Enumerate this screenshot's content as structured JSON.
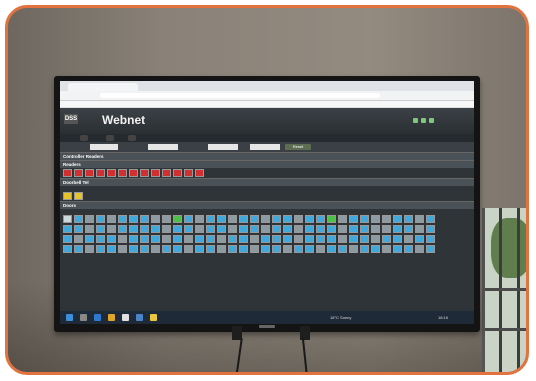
{
  "scene": {
    "frame_color": "#e2733f",
    "wall_color": "#8a8278"
  },
  "browser": {
    "tab_label": "",
    "url": ""
  },
  "app": {
    "title": "Webnet",
    "logo_text": "DSS",
    "subtitle": "",
    "header_right": "",
    "tabs": [
      "",
      "",
      ""
    ],
    "reset_label": "Reset"
  },
  "sections": {
    "controller_readers": "Controller Readers",
    "readers": "Readers",
    "readers_sub": "",
    "doorbell": "Doorbell Tel",
    "doorbell_sub": "",
    "doors": "Doors",
    "doors_sub": ""
  },
  "grids": {
    "readers_count": 13,
    "doorbell_count": 2,
    "doors_rows": [
      [
        "light",
        "blue",
        "grey",
        "blue",
        "grey",
        "blue",
        "blue",
        "blue",
        "grey",
        "grey",
        "green",
        "blue",
        "grey",
        "blue",
        "blue",
        "grey",
        "blue",
        "blue",
        "grey",
        "blue",
        "blue",
        "grey",
        "blue",
        "blue",
        "green",
        "grey",
        "blue",
        "blue",
        "grey",
        "grey",
        "blue",
        "blue",
        "grey",
        "blue"
      ],
      [
        "blue",
        "blue",
        "grey",
        "blue",
        "grey",
        "blue",
        "blue",
        "blue",
        "blue",
        "grey",
        "blue",
        "blue",
        "grey",
        "blue",
        "blue",
        "grey",
        "blue",
        "blue",
        "grey",
        "blue",
        "blue",
        "grey",
        "blue",
        "blue",
        "blue",
        "grey",
        "blue",
        "blue",
        "grey",
        "grey",
        "blue",
        "blue",
        "grey",
        "blue"
      ],
      [
        "blue",
        "grey",
        "blue",
        "blue",
        "blue",
        "grey",
        "blue",
        "blue",
        "blue",
        "grey",
        "blue",
        "grey",
        "blue",
        "blue",
        "grey",
        "blue",
        "blue",
        "grey",
        "blue",
        "blue",
        "blue",
        "grey",
        "blue",
        "blue",
        "blue",
        "grey",
        "blue",
        "blue",
        "grey",
        "blue",
        "blue",
        "grey",
        "blue",
        "blue"
      ],
      [
        "blue",
        "blue",
        "grey",
        "blue",
        "blue",
        "grey",
        "blue",
        "blue",
        "grey",
        "blue",
        "blue",
        "grey",
        "blue",
        "blue",
        "grey",
        "blue",
        "blue",
        "grey",
        "blue",
        "blue",
        "grey",
        "blue",
        "blue",
        "grey",
        "blue",
        "blue",
        "grey",
        "blue",
        "blue",
        "grey",
        "blue",
        "blue",
        "grey",
        "blue"
      ]
    ]
  },
  "taskbar": {
    "weather": "18°C Sunny",
    "time": "18:16"
  }
}
